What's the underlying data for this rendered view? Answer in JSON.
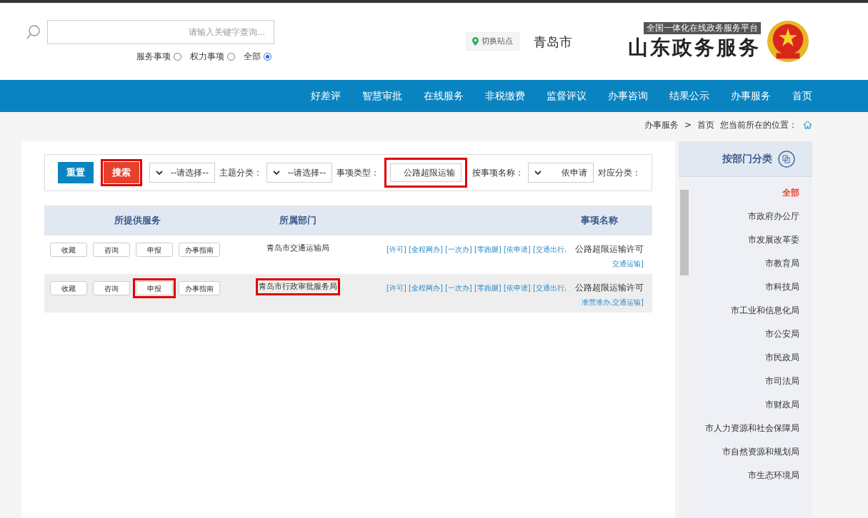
{
  "header": {
    "search": {
      "placeholder": "请输入关键字查询..."
    },
    "scopes": [
      {
        "label": "服务事项",
        "selected": false
      },
      {
        "label": "权力事项",
        "selected": false
      },
      {
        "label": "全部",
        "selected": true
      }
    ],
    "switch_site": "切换站点",
    "city": "青岛市",
    "logo_subtitle": "全国一体化在线政务服务平台",
    "logo_title": "山东政务服务"
  },
  "nav": [
    "好差评",
    "智慧审批",
    "在线服务",
    "非税缴费",
    "监督评议",
    "办事咨询",
    "结果公示",
    "办事服务",
    "首页"
  ],
  "breadcrumb": {
    "items": [
      "办事服务",
      "首页"
    ],
    "separator": ">",
    "label": "您当前所在的位置："
  },
  "reset_button": {
    "label": "重置"
  },
  "search_button": {
    "label": "搜索",
    "highlighted": true
  },
  "filters": [
    {
      "label": "主题分类：",
      "kind": "select",
      "value": "--请选择--",
      "highlighted": false
    },
    {
      "label": "事项类型：",
      "kind": "select",
      "value": "--请选择--",
      "highlighted": false
    },
    {
      "label": "按事项名称：",
      "kind": "input",
      "value": "公路超限运输",
      "highlighted": true
    },
    {
      "label": "对应分类：",
      "kind": "select",
      "value": "依申请",
      "highlighted": false
    }
  ],
  "table": {
    "columns": [
      "所提供服务",
      "所属部门",
      "事项名称"
    ],
    "rows": [
      {
        "services": [
          {
            "label": "收藏",
            "highlighted": false
          },
          {
            "label": "咨询",
            "highlighted": false
          },
          {
            "label": "申报",
            "highlighted": false
          },
          {
            "label": "办事指南",
            "highlighted": false
          }
        ],
        "department": "青岛市交通运输局",
        "department_highlighted": false,
        "tags": "[许可] [全程网办] [一次办] [零跑腿] [依申请] [交通出行,",
        "name": "公路超限运输许可",
        "tags_2": "交通运输]",
        "selected": false
      },
      {
        "services": [
          {
            "label": "收藏",
            "highlighted": false
          },
          {
            "label": "咨询",
            "highlighted": false
          },
          {
            "label": "申报",
            "highlighted": true
          },
          {
            "label": "办事指南",
            "highlighted": false
          }
        ],
        "department": "青岛市行政审批服务局",
        "department_highlighted": true,
        "tags": "[许可] [全程网办] [一次办] [零跑腿] [依申请] [交通出行,",
        "name": "公路超限运输许可",
        "tags_2": "准营准办,交通运输]",
        "selected": true
      }
    ]
  },
  "sidebar": {
    "title": "按部门分类",
    "items": [
      {
        "label": "全部",
        "selected": true
      },
      {
        "label": "市政府办公厅",
        "selected": false
      },
      {
        "label": "市发展改革委",
        "selected": false
      },
      {
        "label": "市教育局",
        "selected": false
      },
      {
        "label": "市科技局",
        "selected": false
      },
      {
        "label": "市工业和信息化局",
        "selected": false
      },
      {
        "label": "市公安局",
        "selected": false
      },
      {
        "label": "市民政局",
        "selected": false
      },
      {
        "label": "市司法局",
        "selected": false
      },
      {
        "label": "市财政局",
        "selected": false
      },
      {
        "label": "市人力资源和社会保障局",
        "selected": false
      },
      {
        "label": "市自然资源和规划局",
        "selected": false
      },
      {
        "label": "市生态环境局",
        "selected": false
      }
    ]
  }
}
